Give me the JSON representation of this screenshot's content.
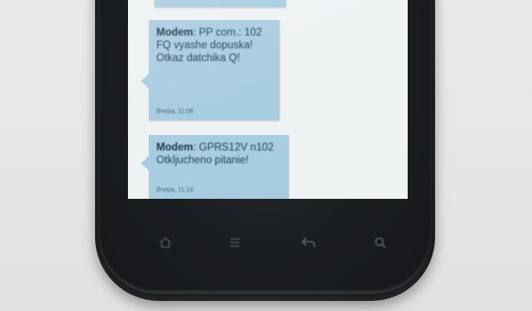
{
  "messages": [
    {
      "sender": "Modem",
      "text": "PP com.: 102\nFQ vyashe dopuska!\nOtkaz datchika Q!",
      "meta": "Вчера, 11:06"
    },
    {
      "sender": "Modem",
      "text": "GPRS12V n102\nOtkljucheno pitanie!",
      "meta": "Вчера, 11:18"
    }
  ],
  "nav_icons": [
    "home-icon",
    "menu-icon",
    "back-icon",
    "search-icon"
  ],
  "colors": {
    "bubble": "#a9cde0",
    "screen": "#eef2f3",
    "phone_body": "#1b1e21",
    "background": "#e6e4e5"
  }
}
